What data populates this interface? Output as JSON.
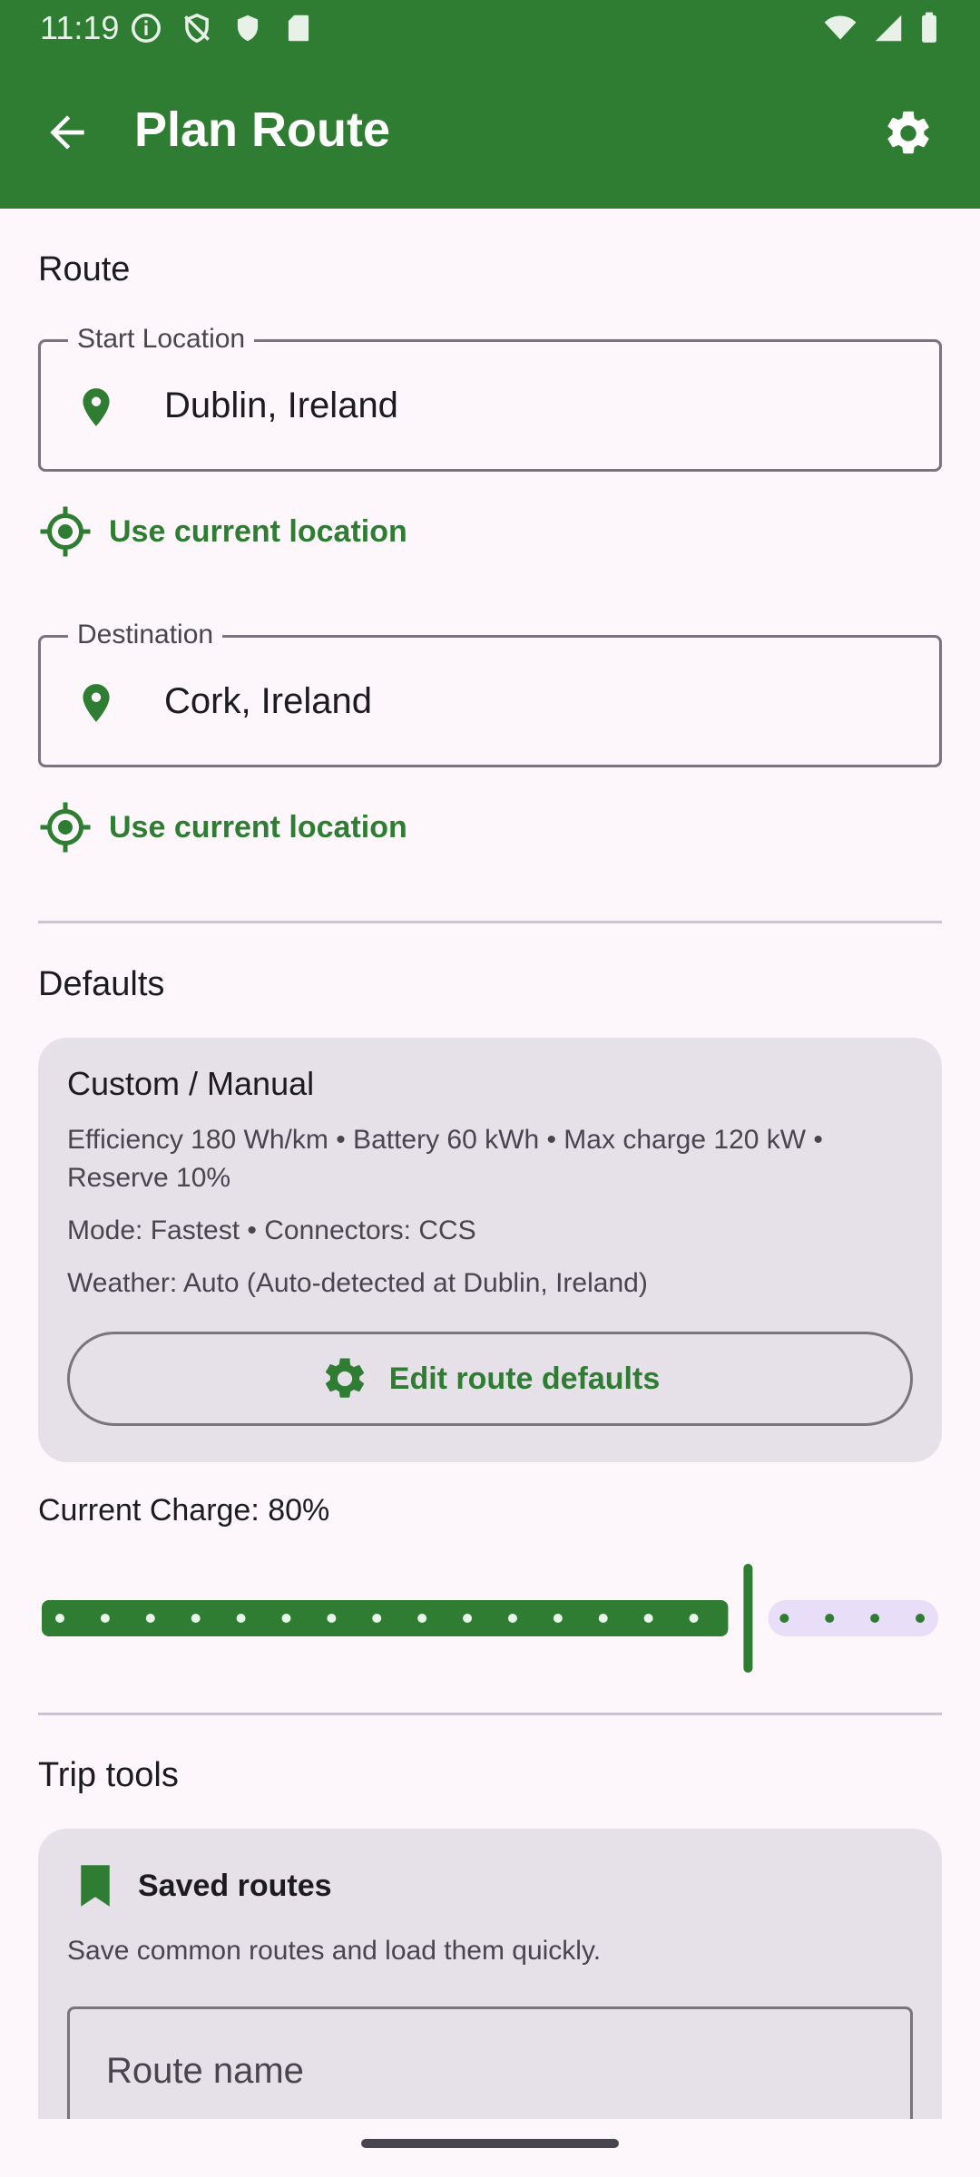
{
  "status": {
    "time": "11:19"
  },
  "appbar": {
    "title": "Plan Route"
  },
  "route": {
    "section_title": "Route",
    "start": {
      "label": "Start Location",
      "value": "Dublin, Ireland"
    },
    "destination": {
      "label": "Destination",
      "value": "Cork, Ireland"
    },
    "use_current": "Use current location"
  },
  "defaults": {
    "section_title": "Defaults",
    "profile": "Custom / Manual",
    "specs": "Efficiency 180 Wh/km • Battery 60 kWh • Max charge 120 kW • Reserve 10%",
    "mode": "Mode: Fastest • Connectors: CCS",
    "weather": "Weather: Auto (Auto-detected at Dublin, Ireland)",
    "edit_button": "Edit route defaults"
  },
  "charge": {
    "label": "Current Charge: 80%",
    "value": 80,
    "min": 0,
    "max": 100
  },
  "trip_tools": {
    "section_title": "Trip tools",
    "saved_title": "Saved routes",
    "saved_desc": "Save common routes and load them quickly.",
    "route_name_placeholder": "Route name"
  },
  "colors": {
    "primary": "#2e7d32",
    "surface": "#fdf7fb",
    "card": "#e6e0e9",
    "inactive_track": "#e8def8"
  }
}
